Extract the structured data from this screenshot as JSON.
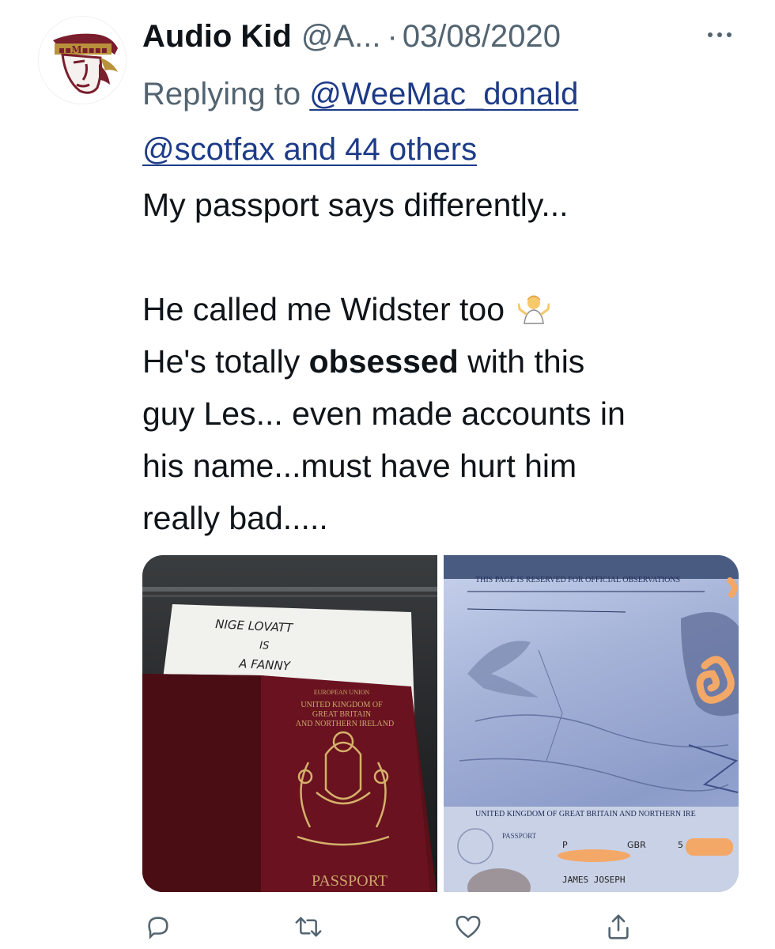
{
  "tweet": {
    "author_name": "Audio Kid",
    "author_handle": "@A...",
    "separator": "·",
    "date": "03/08/2020",
    "replying_prefix": "Replying to",
    "reply_to_user": "@WeeMac_donald",
    "reply_to_others": "@scotfax and 44 others",
    "text": {
      "line1": "My passport says differently...",
      "line2": "He called me Widster too",
      "line3_before": "He's totally",
      "line3_bold": "obsessed",
      "line3_after": "with this",
      "line4": "guy Les... even made accounts in",
      "line5": "his name...must have hurt him",
      "line6": "really bad....."
    },
    "emoji": "person-shrugging-emoji"
  },
  "media": {
    "left_image": {
      "note_lines": [
        "NIGE LOVATT",
        "IS",
        "A FANNY"
      ],
      "cover_lines": [
        "EUROPEAN UNION",
        "UNITED KINGDOM OF",
        "GREAT BRITAIN",
        "AND NORTHERN IRELAND"
      ],
      "cover_title": "PASSPORT"
    },
    "right_image": {
      "top_text": "THIS PAGE IS RESERVED FOR OFFICIAL OBSERVATIONS",
      "bottom_text": "UNITED KINGDOM OF GREAT BRITAIN AND NORTHERN IRE",
      "field_labels": [
        "PASSPORT",
        "P",
        "GBR",
        "5"
      ],
      "holder_name": "JAMES JOSEPH"
    }
  },
  "icons": {
    "avatar": "team-logo-avatar",
    "more": "more-options-icon",
    "reply": "reply-icon",
    "retweet": "retweet-icon",
    "like": "like-icon",
    "share": "share-icon"
  },
  "colors": {
    "text": "#0f1419",
    "secondary": "#536471",
    "link": "#1d3b88",
    "passport_cover": "#6a1220",
    "redaction": "#f3a867"
  }
}
